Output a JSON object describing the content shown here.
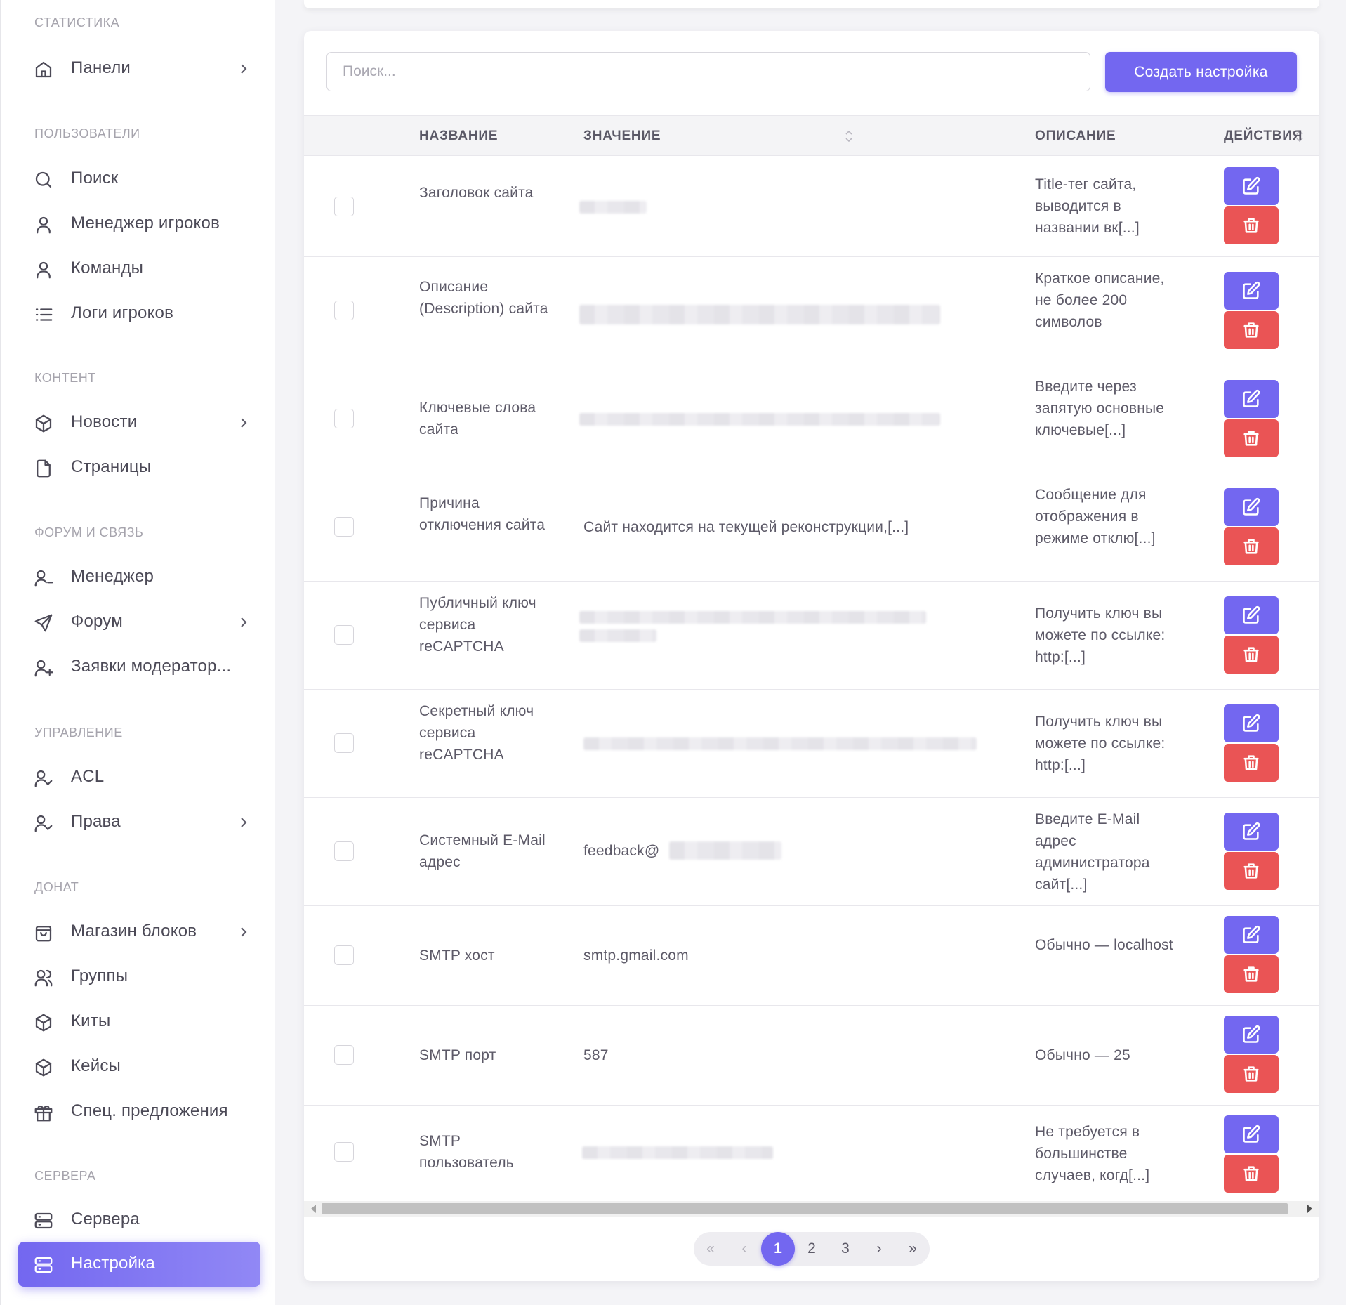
{
  "sidebar": {
    "sections": [
      {
        "title": "СТАТИСТИКА",
        "items": [
          {
            "label": "Панели",
            "icon": "home-icon",
            "chevron": true
          }
        ]
      },
      {
        "title": "ПОЛЬЗОВАТЕЛИ",
        "items": [
          {
            "label": "Поиск",
            "icon": "search-icon",
            "chevron": false
          },
          {
            "label": "Менеджер игроков",
            "icon": "user-icon",
            "chevron": false
          },
          {
            "label": "Команды",
            "icon": "user-icon",
            "chevron": false
          },
          {
            "label": "Логи игроков",
            "icon": "list-icon",
            "chevron": false
          }
        ]
      },
      {
        "title": "КОНТЕНТ",
        "items": [
          {
            "label": "Новости",
            "icon": "box-icon",
            "chevron": true
          },
          {
            "label": "Страницы",
            "icon": "file-icon",
            "chevron": false
          }
        ]
      },
      {
        "title": "ФОРУМ И СВЯЗЬ",
        "items": [
          {
            "label": "Менеджер",
            "icon": "user-minus-icon",
            "chevron": false
          },
          {
            "label": "Форум",
            "icon": "send-icon",
            "chevron": true
          },
          {
            "label": "Заявки модератор...",
            "icon": "user-plus-icon",
            "chevron": false
          }
        ]
      },
      {
        "title": "УПРАВЛЕНИЕ",
        "items": [
          {
            "label": "ACL",
            "icon": "user-check-icon",
            "chevron": false
          },
          {
            "label": "Права",
            "icon": "user-check-icon",
            "chevron": true
          }
        ]
      },
      {
        "title": "ДОНАТ",
        "items": [
          {
            "label": "Магазин блоков",
            "icon": "shopping-bag-icon",
            "chevron": true
          },
          {
            "label": "Группы",
            "icon": "users-icon",
            "chevron": false
          },
          {
            "label": "Киты",
            "icon": "box-icon",
            "chevron": false
          },
          {
            "label": "Кейсы",
            "icon": "box-icon",
            "chevron": false
          },
          {
            "label": "Спец. предложения",
            "icon": "gift-icon",
            "chevron": false
          }
        ]
      },
      {
        "title": "СЕРВЕРА",
        "items": [
          {
            "label": "Сервера",
            "icon": "server-icon",
            "chevron": false
          },
          {
            "label": "Настройка",
            "icon": "server-icon",
            "chevron": false,
            "active": true
          }
        ]
      }
    ]
  },
  "toolbar": {
    "search_placeholder": "Поиск...",
    "create_label": "Создать настройка"
  },
  "table": {
    "columns": {
      "name": "НАЗВАНИЕ",
      "value": "ЗНАЧЕНИЕ",
      "description": "ОПИСАНИЕ",
      "actions": "ДЕЙСТВИЯ"
    },
    "rows": [
      {
        "name": "Заголовок сайта",
        "value": "",
        "description": "Title-тег сайта, выводится в названии вк[...]"
      },
      {
        "name": "Описание (Description) сайта",
        "value": "",
        "description": "Краткое описание, не более 200 символов"
      },
      {
        "name": "Ключевые слова сайта",
        "value": "",
        "description": "Введите через запятую основные ключевые[...]"
      },
      {
        "name": "Причина отключения сайта",
        "value": "Сайт находится на текущей реконструкции,[...]",
        "description": "Сообщение для отображения в режиме отклю[...]"
      },
      {
        "name": "Публичный ключ сервиса reCAPTCHA",
        "value": "",
        "description": "Получить ключ вы можете по ссылке: http:[...]"
      },
      {
        "name": "Секретный ключ сервиса reCAPTCHA",
        "value": "",
        "description": "Получить ключ вы можете по ссылке: http:[...]"
      },
      {
        "name": "Системный E-Mail адрес",
        "value": "feedback@",
        "description": "Введите E-Mail адрес администратора сайт[...]"
      },
      {
        "name": "SMTP хост",
        "value": "smtp.gmail.com",
        "description": "Обычно — localhost"
      },
      {
        "name": "SMTP порт",
        "value": "587",
        "description": "Обычно — 25"
      },
      {
        "name": "SMTP пользователь",
        "value": "",
        "description": "Не требуется в большинстве случаев, когд[...]"
      }
    ]
  },
  "pagination": {
    "first": "«",
    "prev": "‹",
    "pages": [
      "1",
      "2",
      "3"
    ],
    "current": "1",
    "next": "›",
    "last": "»"
  },
  "colors": {
    "primary": "#7367f0",
    "danger": "#ea5455"
  }
}
